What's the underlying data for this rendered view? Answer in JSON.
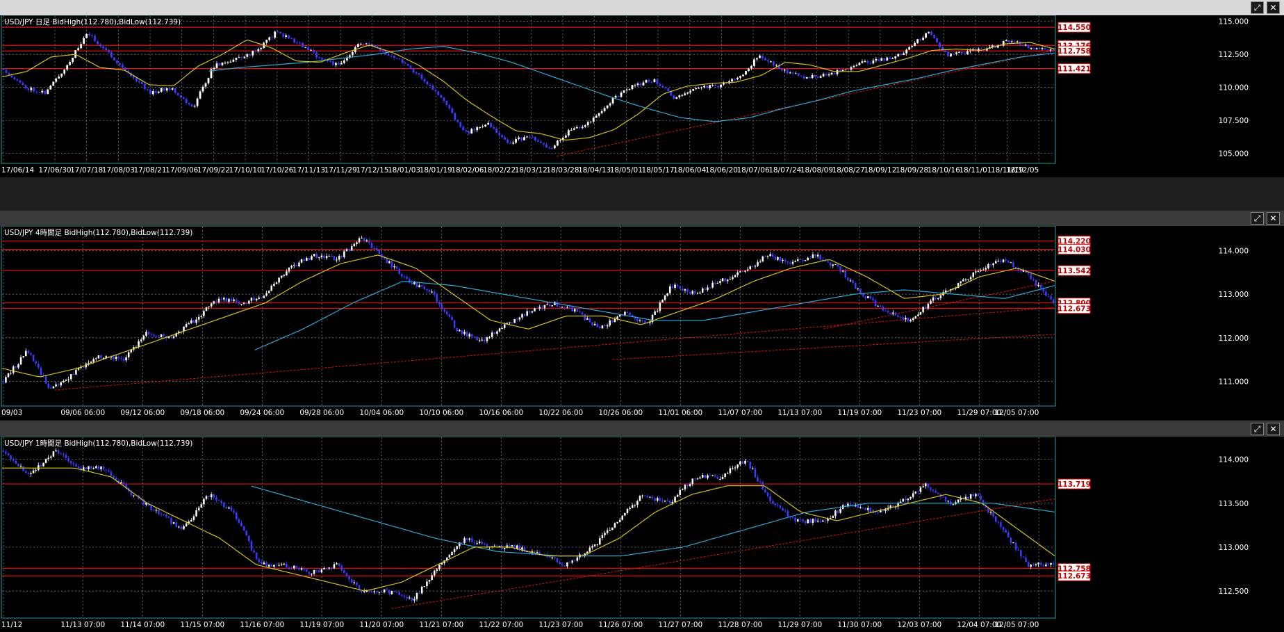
{
  "colors": {
    "background": "#000000",
    "frame": "#2a9aa0",
    "grid": "#8a8a8a",
    "up_candle": "#ffffff",
    "down_candle": "#3b3bff",
    "ma_short": "#d4c21a",
    "ma_long": "#2aa8d8",
    "levels": "#e01010",
    "axis_text": "#ffffff"
  },
  "icons": {
    "maximize": "⤢",
    "close": "✕"
  },
  "chart_data": [
    {
      "type": "candlestick",
      "title": "USD/JPY 日足  BidHigh(112.780),BidLow(112.739)",
      "ylim": [
        104.3,
        115.4
      ],
      "y_ticks": [
        105.0,
        107.5,
        110.0,
        112.5,
        115.0
      ],
      "x_labels": [
        "17/06/14",
        "17/06/30",
        "17/07/18",
        "17/08/03",
        "17/08/21",
        "17/09/06",
        "17/09/22",
        "17/10/10",
        "17/10/26",
        "17/11/13",
        "17/11/29",
        "17/12/15",
        "18/01/03",
        "18/01/19",
        "18/02/06",
        "18/02/22",
        "18/03/12",
        "18/03/28",
        "18/04/13",
        "18/05/01",
        "18/05/17",
        "18/06/04",
        "18/06/20",
        "18/07/06",
        "18/07/24",
        "18/08/09",
        "18/08/27",
        "18/09/12",
        "18/09/28",
        "18/10/16",
        "18/11/01",
        "18/11/19",
        "18/12/05"
      ],
      "price_path": [
        111.4,
        110.0,
        109.6,
        111.6,
        114.1,
        112.6,
        111.0,
        109.6,
        110.0,
        108.4,
        111.6,
        112.1,
        112.7,
        114.2,
        113.4,
        112.3,
        111.6,
        113.4,
        112.8,
        112.0,
        110.6,
        108.9,
        106.5,
        107.3,
        105.8,
        106.3,
        105.3,
        106.8,
        107.4,
        109.1,
        110.1,
        110.6,
        109.1,
        110.0,
        110.1,
        110.7,
        112.4,
        111.4,
        110.8,
        110.9,
        111.3,
        111.9,
        112.1,
        112.7,
        114.2,
        112.4,
        112.7,
        113.0,
        113.6,
        113.0,
        112.7
      ],
      "ma_short": [
        110.8,
        111.2,
        112.3,
        112.5,
        111.5,
        111.3,
        110.2,
        110.1,
        111.6,
        112.5,
        113.6,
        113.0,
        112.0,
        111.9,
        112.6,
        113.2,
        112.6,
        111.7,
        110.5,
        109.0,
        107.8,
        106.7,
        106.5,
        106.0,
        106.2,
        106.8,
        108.0,
        109.5,
        110.1,
        110.3,
        110.4,
        110.9,
        111.9,
        111.7,
        111.2,
        111.2,
        111.7,
        112.2,
        112.8,
        112.9,
        112.8,
        113.3,
        113.4,
        112.9
      ],
      "ma_long": [
        null,
        null,
        null,
        null,
        null,
        null,
        111.2,
        111.5,
        111.7,
        111.9,
        112.2,
        112.5,
        112.9,
        113.1,
        112.6,
        111.9,
        111.0,
        110.1,
        109.2,
        108.4,
        107.7,
        107.4,
        107.7,
        108.4,
        109.0,
        109.7,
        110.2,
        110.7,
        111.3,
        111.8,
        112.3,
        112.6
      ],
      "levels": [
        {
          "price": 114.55,
          "label": "114.550",
          "style": "solid"
        },
        {
          "price": 113.176,
          "label": "113.176",
          "style": "solid"
        },
        {
          "price": 112.758,
          "label": "112.758",
          "style": "solid"
        },
        {
          "price": 111.421,
          "label": "111.421",
          "style": "solid"
        }
      ],
      "trendlines": [
        {
          "from": [
            0.527,
            104.8
          ],
          "to": [
            1.0,
            112.8
          ]
        }
      ]
    },
    {
      "type": "candlestick",
      "title": "USD/JPY 4時間足  BidHigh(112.780),BidLow(112.739)",
      "ylim": [
        110.45,
        114.55
      ],
      "y_ticks": [
        111.0,
        112.0,
        113.0,
        114.0
      ],
      "x_labels": [
        "09/03",
        "09/06 06:00",
        "09/12 06:00",
        "09/18 06:00",
        "09/24 06:00",
        "09/28 06:00",
        "10/04 06:00",
        "10/10 06:00",
        "10/16 06:00",
        "10/22 06:00",
        "10/26 06:00",
        "11/01 06:00",
        "11/07 07:00",
        "11/13 07:00",
        "11/19 07:00",
        "11/23 07:00",
        "11/29 07:00",
        "12/05 07:00"
      ],
      "price_path": [
        111.0,
        111.7,
        110.8,
        111.2,
        111.6,
        111.5,
        112.1,
        112.0,
        112.4,
        112.9,
        112.8,
        113.0,
        113.6,
        113.9,
        113.8,
        114.3,
        113.8,
        113.3,
        113.0,
        112.2,
        111.9,
        112.3,
        112.6,
        112.8,
        112.6,
        112.2,
        112.6,
        112.3,
        113.2,
        113.0,
        113.3,
        113.5,
        113.9,
        113.7,
        113.9,
        113.6,
        113.0,
        112.6,
        112.4,
        112.9,
        113.2,
        113.6,
        113.8,
        113.4,
        112.8
      ],
      "ma_short": [
        111.3,
        111.1,
        111.3,
        111.6,
        111.9,
        112.2,
        112.5,
        112.8,
        113.3,
        113.7,
        113.9,
        113.6,
        113.0,
        112.4,
        112.2,
        112.5,
        112.5,
        112.3,
        112.6,
        112.9,
        113.3,
        113.6,
        113.8,
        113.4,
        112.9,
        113.0,
        113.4,
        113.6,
        113.3
      ],
      "ma_long": [
        null,
        null,
        null,
        null,
        null,
        111.7,
        112.2,
        112.8,
        113.3,
        113.2,
        113.0,
        112.8,
        112.6,
        112.4,
        112.4,
        112.6,
        112.8,
        113.0,
        113.1,
        113.0,
        112.9,
        113.2
      ],
      "levels": [
        {
          "price": 114.22,
          "label": "114.220",
          "style": "solid"
        },
        {
          "price": 114.03,
          "label": "114.030",
          "style": "solid"
        },
        {
          "price": 113.542,
          "label": "113.542",
          "style": "solid"
        },
        {
          "price": 112.8,
          "label": "112.800",
          "style": "solid"
        },
        {
          "price": 112.673,
          "label": "112.673",
          "style": "solid"
        }
      ],
      "trendlines": [
        {
          "from": [
            0.05,
            110.8
          ],
          "to": [
            1.0,
            112.7
          ]
        },
        {
          "from": [
            0.58,
            111.5
          ],
          "to": [
            1.0,
            112.08
          ]
        },
        {
          "from": [
            0.78,
            112.2
          ],
          "to": [
            1.0,
            113.3
          ]
        }
      ]
    },
    {
      "type": "candlestick",
      "title": "USD/JPY 1時間足  BidHigh(112.780),BidLow(112.739)",
      "ylim": [
        112.2,
        114.25
      ],
      "y_ticks": [
        112.5,
        113.0,
        113.5,
        114.0
      ],
      "x_labels": [
        "11/12",
        "11/13 07:00",
        "11/14 07:00",
        "11/15 07:00",
        "11/16 07:00",
        "11/19 07:00",
        "11/20 07:00",
        "11/21 07:00",
        "11/22 07:00",
        "11/23 07:00",
        "11/26 07:00",
        "11/27 07:00",
        "11/28 07:00",
        "11/29 07:00",
        "11/30 07:00",
        "12/03 07:00",
        "12/04 07:00",
        "12/05 07:00"
      ],
      "price_path": [
        114.1,
        113.8,
        114.1,
        113.9,
        113.9,
        113.6,
        113.4,
        113.2,
        113.6,
        113.4,
        112.8,
        112.8,
        112.7,
        112.8,
        112.5,
        112.5,
        112.4,
        112.8,
        113.1,
        113.0,
        113.0,
        112.9,
        112.8,
        113.0,
        113.3,
        113.6,
        113.5,
        113.8,
        113.8,
        114.0,
        113.5,
        113.3,
        113.3,
        113.5,
        113.4,
        113.5,
        113.7,
        113.5,
        113.6,
        113.2,
        112.8,
        112.8
      ],
      "ma_short": [
        113.9,
        113.9,
        113.9,
        113.8,
        113.5,
        113.3,
        113.1,
        112.8,
        112.7,
        112.6,
        112.5,
        112.6,
        112.8,
        113.0,
        113.0,
        112.9,
        112.9,
        113.1,
        113.4,
        113.6,
        113.7,
        113.7,
        113.4,
        113.3,
        113.4,
        113.5,
        113.6,
        113.5,
        113.2,
        112.9
      ],
      "ma_long": [
        null,
        null,
        null,
        null,
        113.7,
        113.5,
        113.3,
        113.1,
        112.95,
        112.9,
        112.9,
        113.0,
        113.2,
        113.4,
        113.5,
        113.5,
        113.5,
        113.4
      ],
      "levels": [
        {
          "price": 113.719,
          "label": "113.719",
          "style": "solid"
        },
        {
          "price": 112.758,
          "label": "112.758",
          "style": "solid"
        },
        {
          "price": 112.673,
          "label": "112.673",
          "style": "solid"
        }
      ],
      "trendlines": [
        {
          "from": [
            0.37,
            112.3
          ],
          "to": [
            1.0,
            113.55
          ]
        }
      ]
    }
  ]
}
